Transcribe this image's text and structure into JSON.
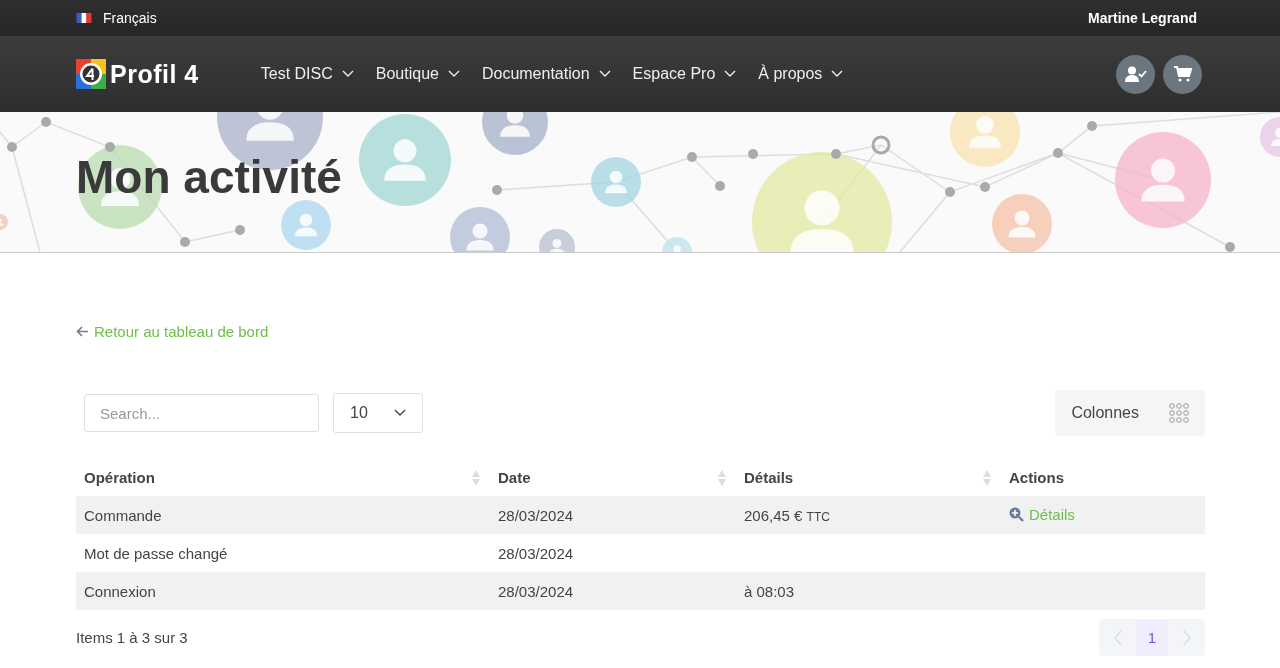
{
  "top_bar": {
    "language": "Français",
    "user": "Martine Legrand"
  },
  "nav": {
    "brand": "Profil 4",
    "menu": [
      {
        "label": "Test DISC"
      },
      {
        "label": "Boutique"
      },
      {
        "label": "Documentation"
      },
      {
        "label": "Espace Pro"
      },
      {
        "label": "À propos"
      }
    ]
  },
  "page_title": "Mon activité",
  "back_link": "Retour au tableau de bord",
  "table_tools": {
    "search": {
      "placeholder": "Search..."
    },
    "page_size": "10",
    "columns_button": "Colonnes"
  },
  "table": {
    "columns": [
      {
        "label": "Opération",
        "sortable": true
      },
      {
        "label": "Date",
        "sortable": true
      },
      {
        "label": "Détails",
        "sortable": true
      },
      {
        "label": "Actions",
        "sortable": false
      }
    ],
    "rows": [
      {
        "operation": "Commande",
        "date": "28/03/2024",
        "details": "206,45 €",
        "details_suffix": "TTC",
        "action": "Détails"
      },
      {
        "operation": "Mot de passe changé",
        "date": "28/03/2024"
      },
      {
        "operation": "Connexion",
        "date": "28/03/2024",
        "details": "à 08:03"
      }
    ]
  },
  "footer": {
    "summary": "Items 1 à 3 sur 3",
    "pagination": {
      "prev_disabled": true,
      "next_disabled": true,
      "pages": [
        {
          "label": "1",
          "selected": true
        }
      ]
    }
  }
}
